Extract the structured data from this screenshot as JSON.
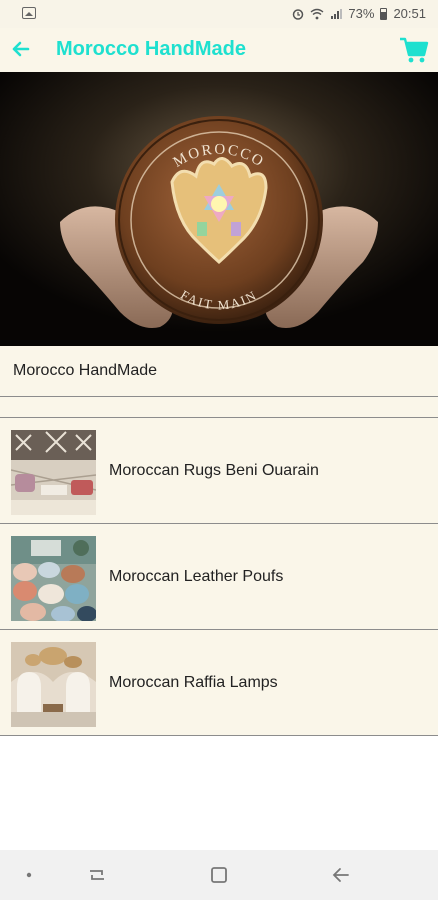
{
  "status_bar": {
    "battery": "73%",
    "time": "20:51"
  },
  "app_bar": {
    "title": "Morocco HandMade",
    "accent_color": "#1ee0cf"
  },
  "banner": {
    "ring_top_text": "MOROCCO",
    "ring_bottom_text": "FAIT MAIN"
  },
  "shop": {
    "title": "Morocco HandMade"
  },
  "categories": [
    {
      "label": "Moroccan Rugs Beni Ouarain"
    },
    {
      "label": "Moroccan Leather Poufs"
    },
    {
      "label": "Moroccan Raffia Lamps"
    }
  ]
}
